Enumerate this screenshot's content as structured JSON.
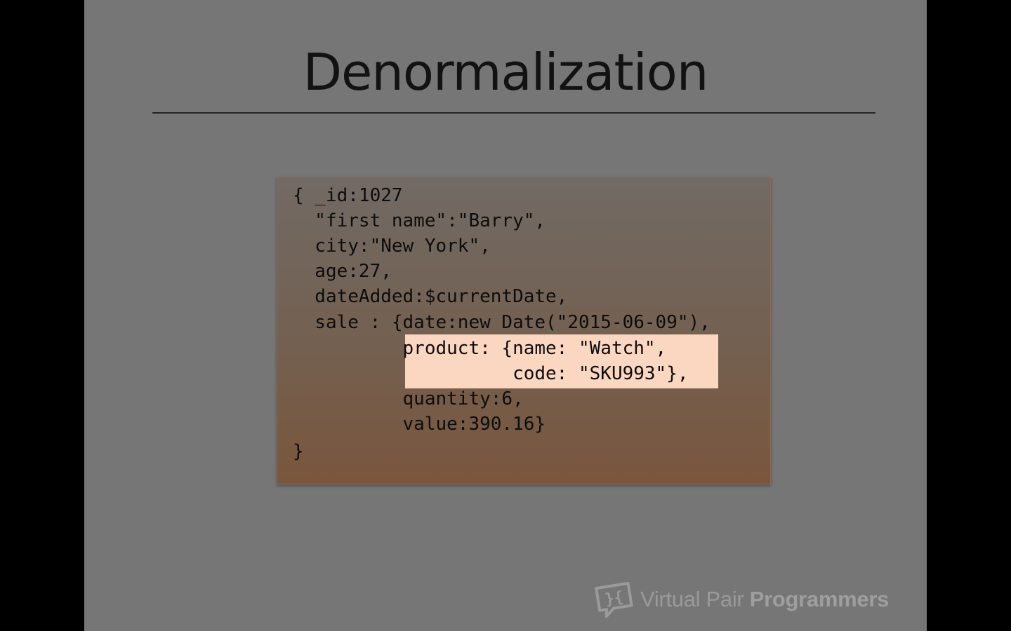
{
  "slide": {
    "title": "Denormalization"
  },
  "code": {
    "lines": [
      "{ _id:1027",
      "  \"first name\":\"Barry\",",
      "  city:\"New York\",",
      "  age:27,",
      "  dateAdded:$currentDate,",
      "  sale : {date:new Date(\"2015-06-09\"),",
      "          product: {name: \"Watch\",",
      "                    code: \"SKU993\"},",
      "          quantity:6,",
      "          value:390.16}",
      "}"
    ],
    "highlighted_lines": [
      6,
      7
    ]
  },
  "branding": {
    "logo_icon": "speech-bubble-braces-icon",
    "name_light": "Virtual Pair ",
    "name_bold": "Programmers"
  },
  "colors": {
    "slide_background": "#767676",
    "letterbox": "#000000",
    "highlight": "#fbd6c0",
    "code_box_top": "#726a64",
    "code_box_bottom": "#7a563c"
  }
}
